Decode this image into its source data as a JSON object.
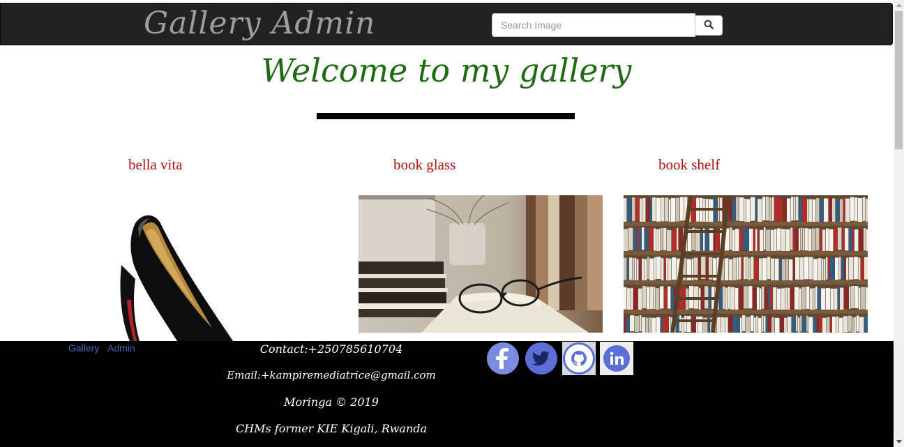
{
  "navbar": {
    "brand": "Gallery  Admin",
    "search": {
      "placeholder": "Search Image",
      "value": ""
    },
    "search_button_icon": "search-icon"
  },
  "heading": {
    "title": "Welcome to my gallery"
  },
  "gallery": {
    "items": [
      {
        "title": "bella vita",
        "image": "red-sole-black-high-heel-shoe"
      },
      {
        "title": "book glass",
        "image": "books-and-eyeglasses-with-flower-vase"
      },
      {
        "title": "book shelf",
        "image": "library-bookshelf-with-wooden-ladder"
      }
    ]
  },
  "footer": {
    "links": [
      {
        "label": "Gallery"
      },
      {
        "label": "Admin"
      }
    ],
    "contact": "Contact:+250785610704",
    "email": "Email:+kampiremediatrice@gmail.com",
    "copyright": "Moringa © 2019",
    "address": "CHMs former KIE Kigali, Rwanda",
    "social": [
      {
        "icon": "facebook-icon"
      },
      {
        "icon": "twitter-icon"
      },
      {
        "icon": "github-icon"
      },
      {
        "icon": "linkedin-icon"
      }
    ]
  },
  "colors": {
    "navbar_bg": "#222222",
    "heading": "#1e6b12",
    "card_title": "#b30f0f",
    "footer_bg": "#000000",
    "footer_link": "#4a63b8",
    "social_accent": "#5b6fd6"
  }
}
